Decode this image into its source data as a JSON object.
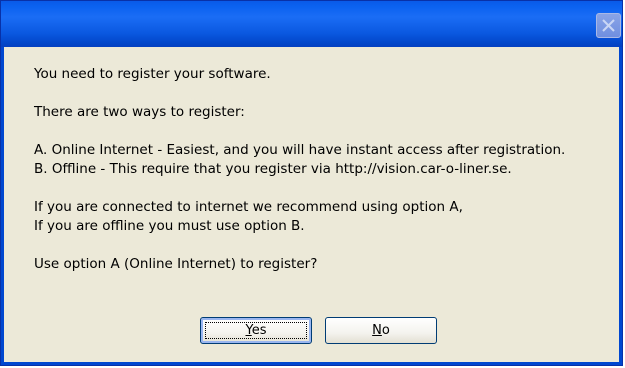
{
  "dialog": {
    "close_icon": "close-icon",
    "message_lines": [
      "You need to register your software.",
      "",
      "There are two ways to register:",
      "",
      "A. Online Internet - Easiest, and you will have instant access after registration.",
      "B. Offline - This require that you register via http://vision.car-o-liner.se.",
      "",
      "If you are connected to internet we recommend using option A,",
      "If you are offline you must use option B.",
      "",
      "Use option A (Online Internet) to register?"
    ],
    "yes_label_mnemonic": "Y",
    "yes_label_rest": "es",
    "no_label_mnemonic": "N",
    "no_label_rest": "o"
  },
  "colors": {
    "titlebar": "#0a58e0",
    "frame": "#0047d0",
    "body": "#ece9d8"
  }
}
